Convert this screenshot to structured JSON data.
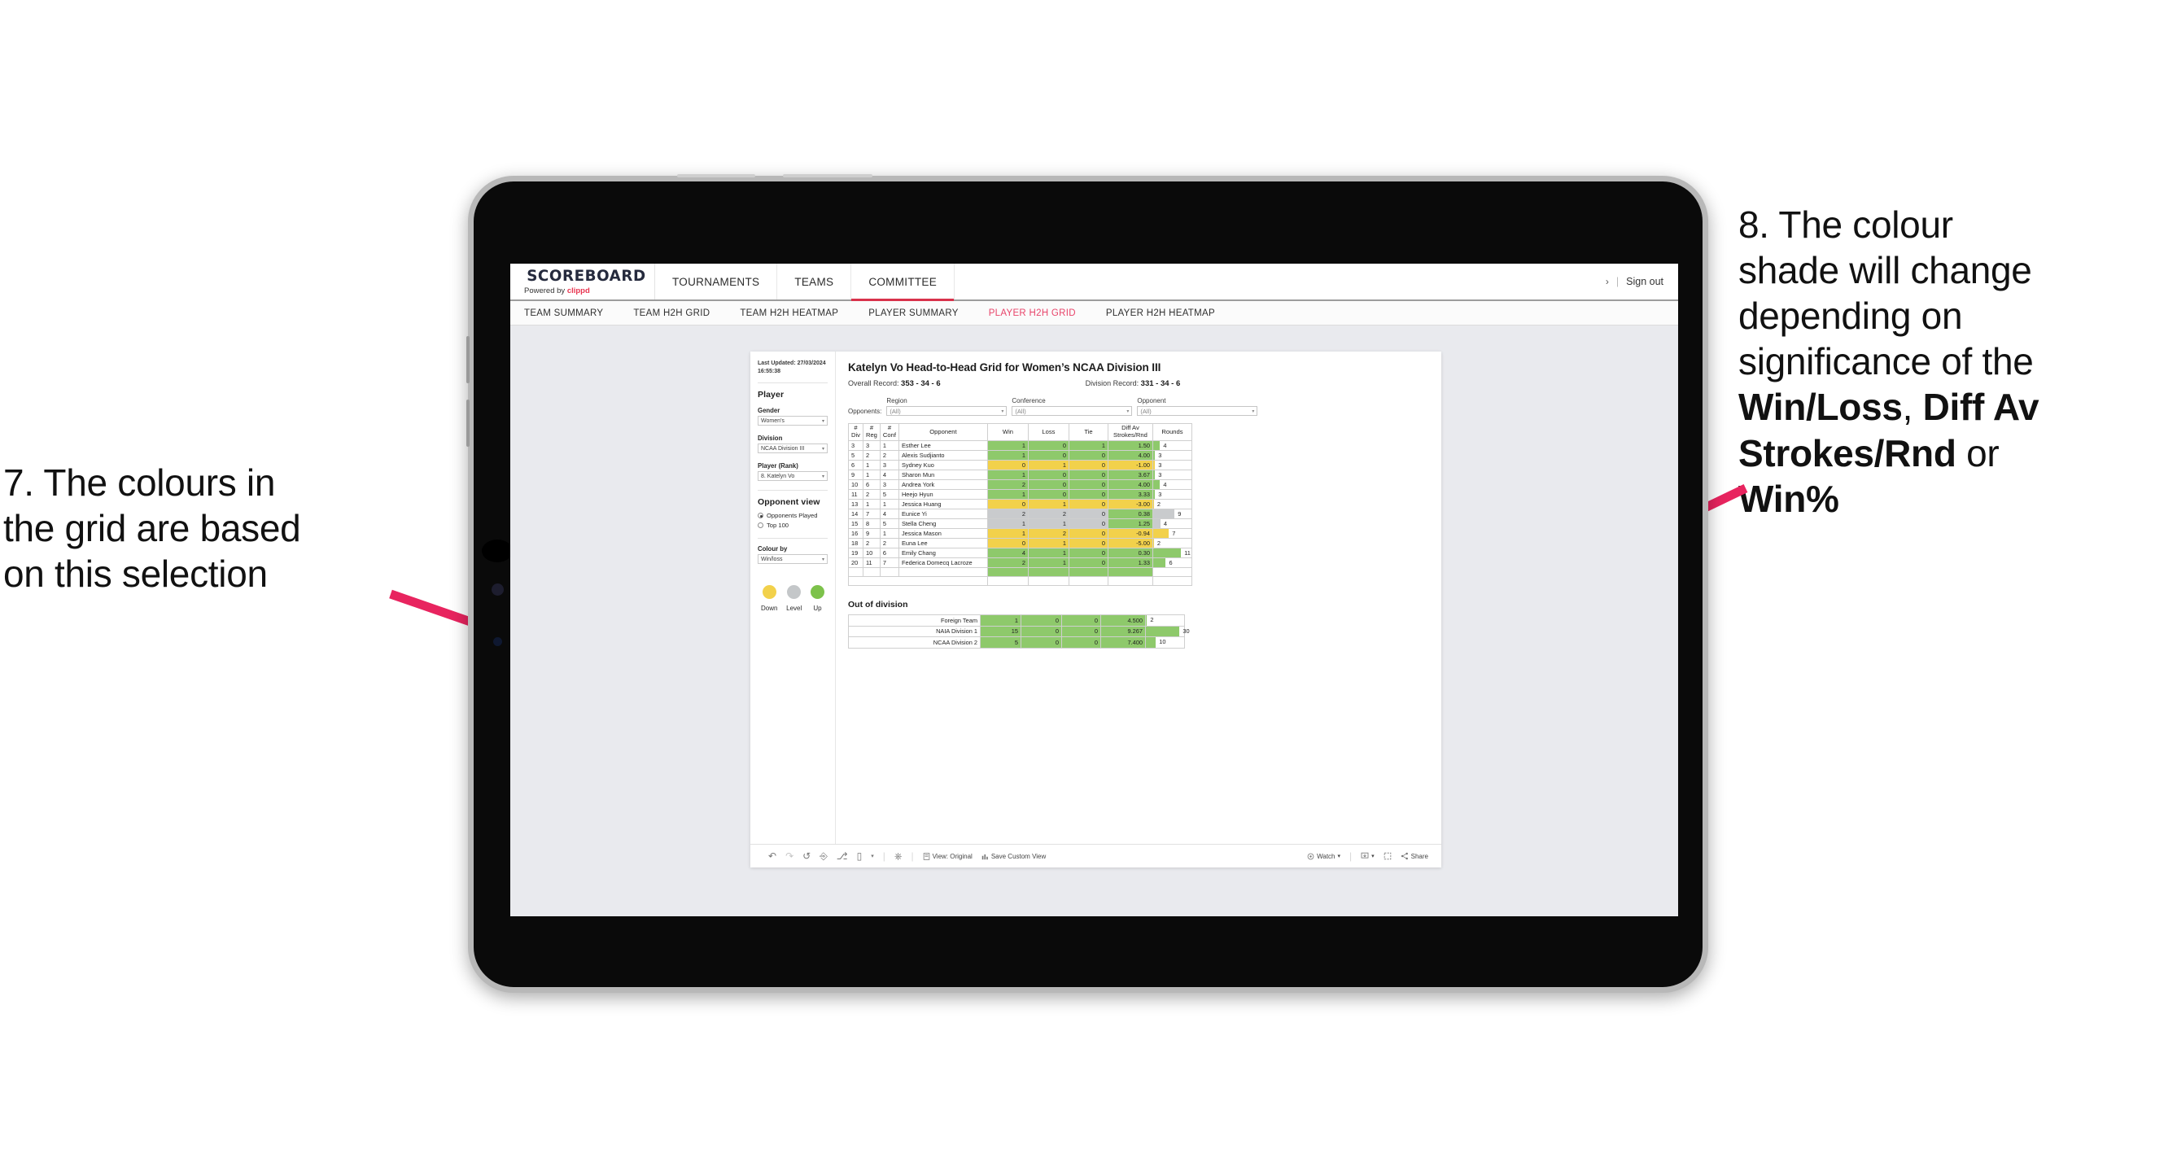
{
  "annotations": {
    "left": {
      "lines": [
        "7. The colours in",
        "the grid are based",
        "on this selection"
      ]
    },
    "right": {
      "line1": "8. The colour",
      "line2": "shade will change",
      "line3": "depending on",
      "line4": "significance of the",
      "bold1": "Win/Loss",
      "mid1": ", ",
      "bold2": "Diff Av",
      "bold3": "Strokes/Rnd",
      "mid2": " or",
      "bold4": "Win%"
    }
  },
  "header": {
    "brand_title": "SCOREBOARD",
    "brand_sub_prefix": "Powered by ",
    "brand_sub_accent": "clippd",
    "nav": [
      {
        "label": "TOURNAMENTS",
        "active": false
      },
      {
        "label": "TEAMS",
        "active": false
      },
      {
        "label": "COMMITTEE",
        "active": true
      }
    ],
    "chevron": "›",
    "separator": "|",
    "sign_out": "Sign out"
  },
  "subnav": {
    "items": [
      {
        "label": "TEAM SUMMARY",
        "active": false
      },
      {
        "label": "TEAM H2H GRID",
        "active": false
      },
      {
        "label": "TEAM H2H HEATMAP",
        "active": false
      },
      {
        "label": "PLAYER SUMMARY",
        "active": false
      },
      {
        "label": "PLAYER H2H GRID",
        "active": true
      },
      {
        "label": "PLAYER H2H HEATMAP",
        "active": false
      }
    ]
  },
  "filters": {
    "last_updated_line1": "Last Updated: 27/03/2024",
    "last_updated_line2": "16:55:38",
    "player_heading": "Player",
    "gender_label": "Gender",
    "gender_value": "Women’s",
    "division_label": "Division",
    "division_value": "NCAA Division III",
    "player_rank_label": "Player (Rank)",
    "player_rank_value": "8. Katelyn Vo",
    "opponent_view_heading": "Opponent view",
    "opponent_view_options": [
      {
        "label": "Opponents Played",
        "selected": true
      },
      {
        "label": "Top 100",
        "selected": false
      }
    ],
    "colour_by_label": "Colour by",
    "colour_by_value": "Win/loss",
    "legend": [
      {
        "label": "Down",
        "color": "#f2d14b"
      },
      {
        "label": "Level",
        "color": "#c4c7c9"
      },
      {
        "label": "Up",
        "color": "#7dc24b"
      }
    ],
    "caret": "▾"
  },
  "main": {
    "title": "Katelyn Vo Head-to-Head Grid for Women’s NCAA Division III",
    "overall_record_label": "Overall Record: ",
    "overall_record_value": "353 -  34 - 6",
    "division_record_label": "Division Record: ",
    "division_record_value": "331 -  34 - 6",
    "opponents_label": "Opponents:",
    "opponent_filters": [
      {
        "label": "Region",
        "value": "(All)"
      },
      {
        "label": "Conference",
        "value": "(All)"
      },
      {
        "label": "Opponent",
        "value": "(All)"
      }
    ],
    "columns": [
      {
        "l1": "#",
        "l2": "Div"
      },
      {
        "l1": "#",
        "l2": "Reg"
      },
      {
        "l1": "#",
        "l2": "Conf"
      },
      {
        "l1": "Opponent",
        "l2": ""
      },
      {
        "l1": "Win",
        "l2": ""
      },
      {
        "l1": "Loss",
        "l2": ""
      },
      {
        "l1": "Tie",
        "l2": ""
      },
      {
        "l1": "Diff Av",
        "l2": "Strokes/Rnd"
      },
      {
        "l1": "Rounds",
        "l2": ""
      }
    ],
    "rows": [
      {
        "div": "3",
        "reg": "3",
        "conf": "1",
        "opponent": "Esther Lee",
        "win": "1",
        "loss": "0",
        "tie": "1",
        "diff": "1.50",
        "rounds": "4",
        "color": "#8ec96b",
        "bar": 18
      },
      {
        "div": "5",
        "reg": "2",
        "conf": "2",
        "opponent": "Alexis Sudjianto",
        "win": "1",
        "loss": "0",
        "tie": "0",
        "diff": "4.00",
        "rounds": "3",
        "color": "#8ec96b",
        "bar": 5
      },
      {
        "div": "6",
        "reg": "1",
        "conf": "3",
        "opponent": "Sydney Kuo",
        "win": "0",
        "loss": "1",
        "tie": "0",
        "diff": "-1.00",
        "rounds": "3",
        "color": "#f2d14b",
        "bar": 5
      },
      {
        "div": "9",
        "reg": "1",
        "conf": "4",
        "opponent": "Sharon Mun",
        "win": "1",
        "loss": "0",
        "tie": "0",
        "diff": "3.67",
        "rounds": "3",
        "color": "#8ec96b",
        "bar": 5
      },
      {
        "div": "10",
        "reg": "6",
        "conf": "3",
        "opponent": "Andrea York",
        "win": "2",
        "loss": "0",
        "tie": "0",
        "diff": "4.00",
        "rounds": "4",
        "color": "#8ec96b",
        "bar": 18
      },
      {
        "div": "11",
        "reg": "2",
        "conf": "5",
        "opponent": "Heejo Hyun",
        "win": "1",
        "loss": "0",
        "tie": "0",
        "diff": "3.33",
        "rounds": "3",
        "color": "#8ec96b",
        "bar": 5
      },
      {
        "div": "13",
        "reg": "1",
        "conf": "1",
        "opponent": "Jessica Huang",
        "win": "0",
        "loss": "1",
        "tie": "0",
        "diff": "-3.00",
        "rounds": "2",
        "color": "#f2d14b",
        "bar": 2
      },
      {
        "div": "14",
        "reg": "7",
        "conf": "4",
        "opponent": "Eunice Yi",
        "win": "2",
        "loss": "2",
        "tie": "0",
        "diff": "0.38",
        "rounds": "9",
        "color": "#c9cbcd",
        "diffcolor": "#8ec96b",
        "bar": 56
      },
      {
        "div": "15",
        "reg": "8",
        "conf": "5",
        "opponent": "Stella Cheng",
        "win": "1",
        "loss": "1",
        "tie": "0",
        "diff": "1.25",
        "rounds": "4",
        "color": "#c9cbcd",
        "diffcolor": "#8ec96b",
        "bar": 19
      },
      {
        "div": "16",
        "reg": "9",
        "conf": "1",
        "opponent": "Jessica Mason",
        "win": "1",
        "loss": "2",
        "tie": "0",
        "diff": "-0.94",
        "rounds": "7",
        "color": "#f2d14b",
        "bar": 41
      },
      {
        "div": "18",
        "reg": "2",
        "conf": "2",
        "opponent": "Euna Lee",
        "win": "0",
        "loss": "1",
        "tie": "0",
        "diff": "-5.00",
        "rounds": "2",
        "color": "#f2d14b",
        "bar": 2
      },
      {
        "div": "19",
        "reg": "10",
        "conf": "6",
        "opponent": "Emily Chang",
        "win": "4",
        "loss": "1",
        "tie": "0",
        "diff": "0.30",
        "rounds": "11",
        "color": "#8ec96b",
        "bar": 73
      },
      {
        "div": "20",
        "reg": "11",
        "conf": "7",
        "opponent": "Federica Domecq Lacroze",
        "win": "2",
        "loss": "1",
        "tie": "0",
        "diff": "1.33",
        "rounds": "6",
        "color": "#8ec96b",
        "bar": 33
      }
    ],
    "out_of_division_title": "Out of division",
    "ood_rows": [
      {
        "name": "Foreign Team",
        "win": "1",
        "loss": "0",
        "tie": "0",
        "diff": "4.500",
        "rounds": "2",
        "color": "#8ec96b",
        "bar": 3
      },
      {
        "name": "NAIA Division 1",
        "win": "15",
        "loss": "0",
        "tie": "0",
        "diff": "9.267",
        "rounds": "30",
        "color": "#8ec96b",
        "bar": 88
      },
      {
        "name": "NCAA Division 2",
        "win": "5",
        "loss": "0",
        "tie": "0",
        "diff": "7.400",
        "rounds": "10",
        "color": "#8ec96b",
        "bar": 26
      }
    ]
  },
  "toolbar": {
    "view_label": "View: Original",
    "save_label": "Save Custom View",
    "watch_label": "Watch",
    "share_label": "Share",
    "caret": "▾"
  },
  "colors": {
    "accent_pink": "#e8446a",
    "brand_red": "#d8324b",
    "green": "#8ec96b",
    "yellow": "#f2d14b",
    "grey": "#c9cbcd",
    "arrow": "#e8245f"
  }
}
